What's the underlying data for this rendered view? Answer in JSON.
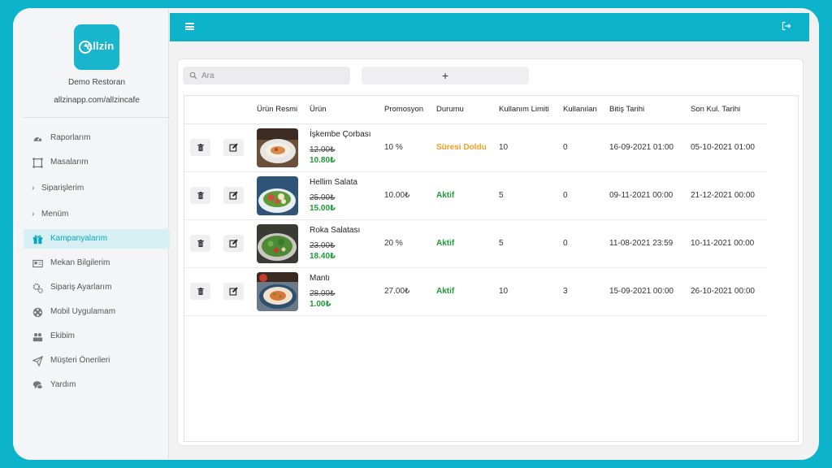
{
  "brand": {
    "logo_text": "allzin",
    "restaurant_name": "Demo Restoran",
    "url": "allzinapp.com/allzincafe"
  },
  "sidebar": {
    "items": [
      {
        "label": "Raporlarım",
        "icon": "gauge-icon",
        "type": "link"
      },
      {
        "label": "Masalarım",
        "icon": "table-icon",
        "type": "link"
      },
      {
        "label": "Siparişlerim",
        "icon": "chevron-right-icon",
        "type": "group"
      },
      {
        "label": "Menüm",
        "icon": "chevron-right-icon",
        "type": "group"
      },
      {
        "label": "Kampanyalarım",
        "icon": "gift-icon",
        "type": "link",
        "active": true
      },
      {
        "label": "Mekan Bilgilerim",
        "icon": "id-card-icon",
        "type": "link"
      },
      {
        "label": "Sipariş Ayarlarım",
        "icon": "gears-icon",
        "type": "link"
      },
      {
        "label": "Mobil Uygulamam",
        "icon": "film-icon",
        "type": "link"
      },
      {
        "label": "Ekibim",
        "icon": "users-icon",
        "type": "link"
      },
      {
        "label": "Müşteri Önerileri",
        "icon": "paper-plane-icon",
        "type": "link"
      },
      {
        "label": "Yardım",
        "icon": "chat-icon",
        "type": "link"
      }
    ]
  },
  "toolbar": {
    "search_placeholder": "Ara",
    "add_label": "+"
  },
  "table": {
    "headers": [
      "",
      "",
      "Ürün Resmi",
      "Ürün",
      "Promosyon",
      "Durumu",
      "Kullanım Limiti",
      "Kullanılan",
      "Bitiş Tarihi",
      "Son Kul. Tarihi"
    ],
    "rows": [
      {
        "product": "İşkembe Çorbası",
        "old_price": "12.00₺",
        "new_price": "10.80₺",
        "promotion": "10 %",
        "status": "Süresi Doldu",
        "status_type": "expired",
        "limit": "10",
        "used": "0",
        "end_date": "16-09-2021 01:00",
        "last_use_date": "05-10-2021 01:00",
        "thumb": "soup"
      },
      {
        "product": "Hellim Salata",
        "old_price": "25.00₺",
        "new_price": "15.00₺",
        "promotion": "10.00₺",
        "status": "Aktif",
        "status_type": "active",
        "limit": "5",
        "used": "0",
        "end_date": "09-11-2021 00:00",
        "last_use_date": "21-12-2021 00:00",
        "thumb": "salad"
      },
      {
        "product": "Roka Salatası",
        "old_price": "23.00₺",
        "new_price": "18.40₺",
        "promotion": "20 %",
        "status": "Aktif",
        "status_type": "active",
        "limit": "5",
        "used": "0",
        "end_date": "11-08-2021 23:59",
        "last_use_date": "10-11-2021 00:00",
        "thumb": "arugula"
      },
      {
        "product": "Mantı",
        "old_price": "28.00₺",
        "new_price": "1.00₺",
        "promotion": "27.00₺",
        "status": "Aktif",
        "status_type": "active",
        "limit": "10",
        "used": "3",
        "end_date": "15-09-2021 00:00",
        "last_use_date": "26-10-2021 00:00",
        "thumb": "manti"
      }
    ]
  },
  "colors": {
    "accent": "#0cb3cb",
    "active_status": "#1d9b35",
    "expired_status": "#f0a020"
  }
}
